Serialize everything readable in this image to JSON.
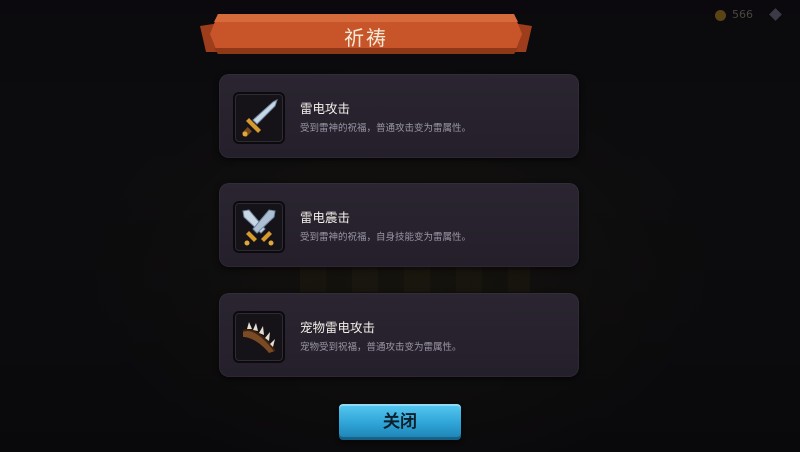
{
  "dialog": {
    "title": "祈祷",
    "close_label": "关闭"
  },
  "skills": [
    {
      "name": "雷电攻击",
      "desc": "受到雷神的祝福，普通攻击变为雷属性。",
      "icon": "sword-icon"
    },
    {
      "name": "雷电震击",
      "desc": "受到雷神的祝福，自身技能变为雷属性。",
      "icon": "crossed-swords-icon"
    },
    {
      "name": "宠物雷电攻击",
      "desc": "宠物受到祝福，普通攻击变为雷属性。",
      "icon": "claw-icon"
    }
  ],
  "hud": {
    "coins": "566"
  },
  "colors": {
    "ribbon": "#c8552a",
    "button": "#2ea3d6",
    "card": "#27222d"
  }
}
